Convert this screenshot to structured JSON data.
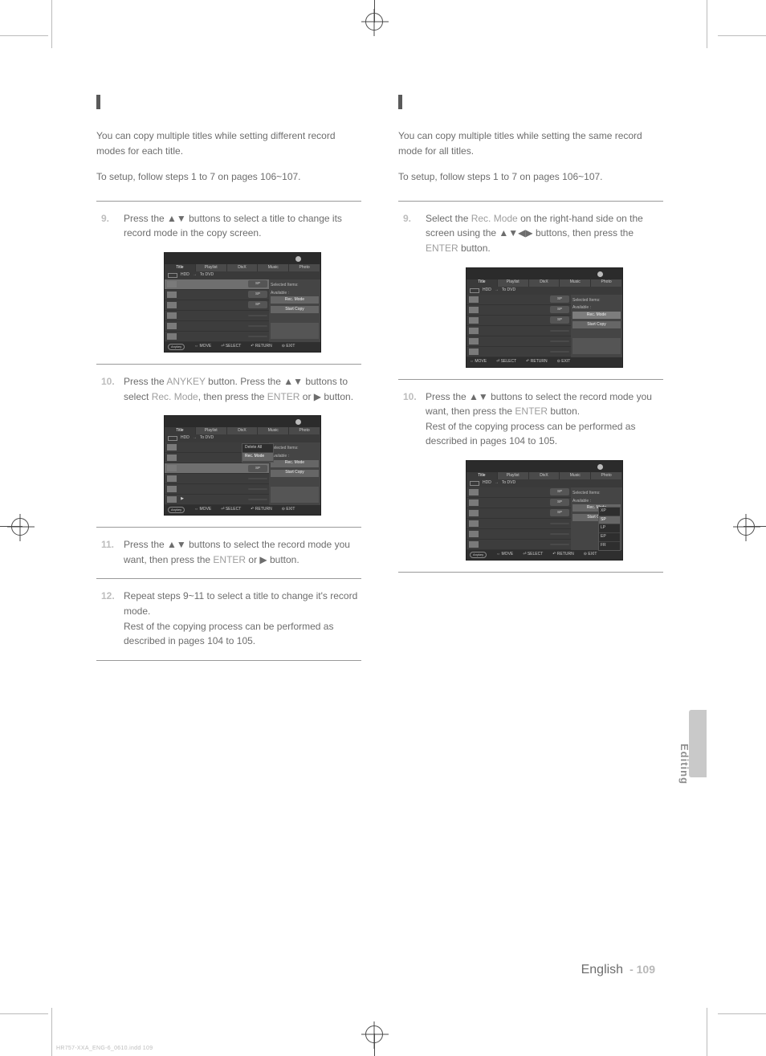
{
  "left": {
    "intro": "You can copy multiple titles while setting different record modes for each title.",
    "setup": "To setup, follow steps 1 to 7 on pages 106~107.",
    "step9": {
      "num": "9.",
      "text_a": "Press the ",
      "arrows": "▲▼",
      "text_b": " buttons to select a title to change its record mode in the copy screen."
    },
    "step10": {
      "num": "10.",
      "text_a": "Press the ",
      "key1": "ANYKEY",
      "text_b": " button. Press the ",
      "arrows": "▲▼",
      "text_c": " buttons to select ",
      "key2": "Rec. Mode",
      "text_d": ", then press the ",
      "key3": "ENTER",
      "text_e": " or ",
      "arrow_r": "▶",
      "text_f": " button."
    },
    "step11": {
      "num": "11.",
      "text_a": "Press the ",
      "arrows": "▲▼",
      "text_b": " buttons to select the record mode you want, then press the ",
      "key1": "ENTER",
      "text_c": " or ",
      "arrow_r": "▶",
      "text_d": " button."
    },
    "step12": {
      "num": "12.",
      "line1": "Repeat steps 9~11 to select a title to change it's record mode.",
      "line2": "Rest of the copying process can be performed as described in pages 104 to 105."
    }
  },
  "right": {
    "intro": "You can copy multiple titles while setting the same record mode for all titles.",
    "setup": "To setup, follow steps 1 to 7 on pages 106~107.",
    "step9": {
      "num": "9.",
      "text_a": "Select the ",
      "key1": "Rec. Mode",
      "text_b": " on the right-hand side on the screen using the ",
      "arrows": "▲▼◀▶",
      "text_c": " buttons, then press the ",
      "key2": "ENTER",
      "text_d": " button."
    },
    "step10": {
      "num": "10.",
      "text_a": "Press the ",
      "arrows": "▲▼",
      "text_b": " buttons to select the record mode you want, then press the ",
      "key1": "ENTER",
      "text_c": " button.",
      "line2": "Rest of the copying process can be performed as described in pages 104 to 105."
    }
  },
  "screens": {
    "title_hdd": "HDD",
    "title_dvd": "DVD",
    "tab1": "Title",
    "tab2": "Playlist",
    "tab3": "DivX",
    "tab4": "Music",
    "tab5": "Photo",
    "to": "To",
    "selected": "Selected Items:",
    "avail": "Available :",
    "rec_mode": "Rec. Mode",
    "start": "Start Copy",
    "anykey": "Anykey",
    "move": "MOVE",
    "select": "SELECT",
    "return": "RETURN",
    "exit": "EXIT",
    "popup_delete": "Delete All",
    "popup_rec": "Rec. Mode",
    "modes": {
      "sp": "SP",
      "lp": "LP",
      "ep": "EP",
      "xp": "XP",
      "fr": "FR"
    }
  },
  "footer": {
    "lang": "English",
    "page": "- 109"
  },
  "side_tab": "Editing",
  "proc": "HR757-XXA_ENG-6_0610.indd   109"
}
